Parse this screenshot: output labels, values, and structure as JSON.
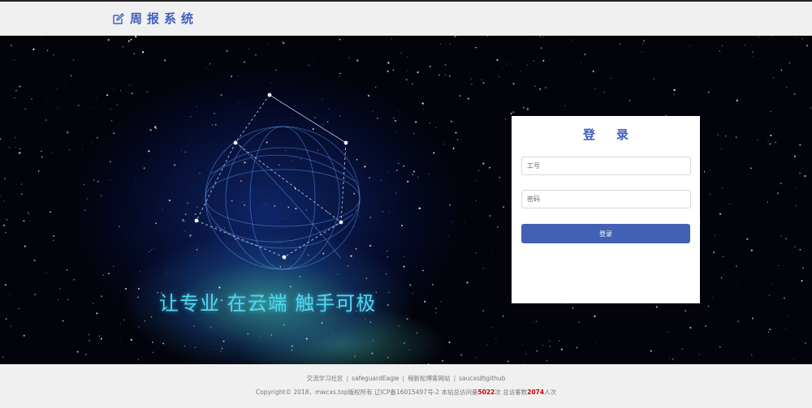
{
  "header": {
    "title": "周报系统",
    "logo_icon": "edit-icon"
  },
  "hero": {
    "slogan": "让专业 在云端 触手可极"
  },
  "login": {
    "title": "登录",
    "id_placeholder": "工号",
    "password_placeholder": "密码",
    "submit_label": "登录"
  },
  "footer": {
    "links": [
      "交流学习社区",
      "safeguardEagle",
      "程新松博客网站",
      "saucxs的github"
    ],
    "separator": "|",
    "copyright_prefix": "Copyright© 2018，mwcxs.top版权所有  辽ICP备16015497号-2  本站总访问量",
    "visits": "5022",
    "visits_suffix": "次  总访客数",
    "visitors": "2074",
    "visitors_suffix": "人次"
  },
  "colors": {
    "accent": "#3e5fbf",
    "button": "#4361b4",
    "highlight": "#cc0000"
  }
}
